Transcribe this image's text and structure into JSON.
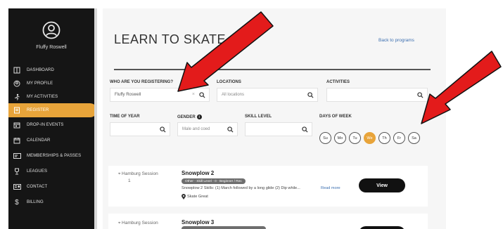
{
  "profile": {
    "name": "Fluffy Roswell",
    "avatar_icon": "user-circle-icon"
  },
  "sidebar": {
    "items": [
      {
        "label": "DASHBOARD",
        "icon": "dashboard-icon",
        "active": false
      },
      {
        "label": "MY PROFILE",
        "icon": "profile-icon",
        "active": false
      },
      {
        "label": "MY ACTIVITIES",
        "icon": "activities-icon",
        "active": false
      },
      {
        "label": "REGISTER",
        "icon": "register-icon",
        "active": true
      },
      {
        "label": "DROP-IN EVENTS",
        "icon": "calendar-event-icon",
        "active": false
      },
      {
        "label": "CALENDAR",
        "icon": "calendar-icon",
        "active": false
      },
      {
        "label": "MEMBERSHIPS & PASSES",
        "icon": "card-icon",
        "active": false
      },
      {
        "label": "LEAGUES",
        "icon": "trophy-icon",
        "active": false
      },
      {
        "label": "CONTACT",
        "icon": "contact-icon",
        "active": false
      },
      {
        "label": "BILLING",
        "icon": "dollar-icon",
        "active": false
      }
    ]
  },
  "page": {
    "title": "LEARN TO SKATE",
    "back_link": "Back to programs"
  },
  "filters": {
    "who_label": "WHO ARE YOU REGISTERING?",
    "who_value": "Fluffy Roswell",
    "who_clear": "×",
    "locations_label": "LOCATIONS",
    "locations_placeholder": "All locations",
    "activities_label": "ACTIVITIES",
    "activities_placeholder": "",
    "time_label": "TIME OF YEAR",
    "time_placeholder": "",
    "gender_label": "GENDER",
    "gender_info_icon": "info-icon",
    "gender_placeholder": "Male and coed",
    "skill_label": "SKILL LEVEL",
    "skill_placeholder": "",
    "days_label": "DAYS OF WEEK",
    "days": [
      {
        "label": "Su",
        "selected": false
      },
      {
        "label": "Mo",
        "selected": false
      },
      {
        "label": "Tu",
        "selected": false
      },
      {
        "label": "We",
        "selected": true
      },
      {
        "label": "Th",
        "selected": false
      },
      {
        "label": "Fr",
        "selected": false
      },
      {
        "label": "Sa",
        "selected": false
      }
    ]
  },
  "programs": [
    {
      "location_line1": "Hamburg Session",
      "location_line2": "1",
      "title": "Snowplow 2",
      "tag": "Other - Skill Level - 0 - Beginner / Rec",
      "description": "Snowplow 2 Skills: (1) March followed by a long glide (2) Dip while...",
      "more": "Read more",
      "site": "Skate Great",
      "view_label": "View"
    },
    {
      "location_line1": "Hamburg Session",
      "title": "Snowplow 3",
      "view_label": "View"
    }
  ],
  "colors": {
    "accent": "#e8a43a",
    "sidebar_bg": "#151515",
    "annotation_arrow": "#e31b1b"
  }
}
